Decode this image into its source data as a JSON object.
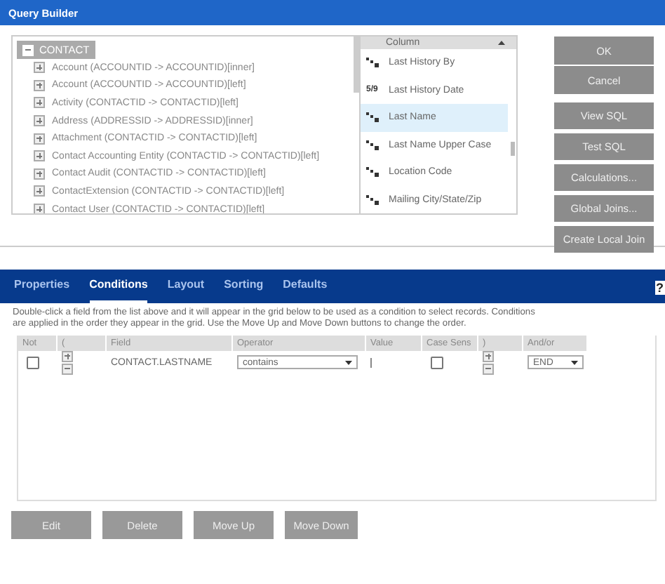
{
  "window": {
    "title": "Query Builder"
  },
  "tree": {
    "label": "CONTACT",
    "expanded": true,
    "children": [
      {
        "label": "Account (ACCOUNTID -> ACCOUNTID)[inner]",
        "expanded": false
      },
      {
        "label": "Account (ACCOUNTID -> ACCOUNTID)[left]",
        "expanded": false
      },
      {
        "label": "Activity (CONTACTID -> CONTACTID)[left]",
        "expanded": false
      },
      {
        "label": "Address (ADDRESSID -> ADDRESSID)[inner]",
        "expanded": false
      },
      {
        "label": "Attachment (CONTACTID -> CONTACTID)[left]",
        "expanded": false
      },
      {
        "label": "Contact Accounting Entity (CONTACTID -> CONTACTID)[left]",
        "expanded": false
      },
      {
        "label": "Contact Audit (CONTACTID -> CONTACTID)[left]",
        "expanded": false
      },
      {
        "label": "ContactExtension (CONTACTID -> CONTACTID)[left]",
        "expanded": false
      },
      {
        "label": "Contact User (CONTACTID -> CONTACTID)[left]",
        "expanded": false
      }
    ]
  },
  "columns": {
    "header": "Column",
    "items": [
      {
        "label": "Last History By",
        "kind": "text",
        "selected": false
      },
      {
        "label": "Last History Date",
        "kind": "date",
        "type_label": "5/9",
        "selected": false
      },
      {
        "label": "Last Name",
        "kind": "text",
        "selected": true
      },
      {
        "label": "Last Name Upper Case",
        "kind": "text",
        "selected": false
      },
      {
        "label": "Location Code",
        "kind": "text",
        "selected": false
      },
      {
        "label": "Mailing City/State/Zip",
        "kind": "text",
        "selected": false
      }
    ]
  },
  "side_buttons": [
    [
      "OK",
      "Cancel"
    ],
    [
      "View SQL",
      "Test SQL",
      "Calculations...",
      "Global Joins...",
      "Create Local Join"
    ]
  ],
  "tabs": [
    {
      "label": "Properties",
      "selected": false
    },
    {
      "label": "Conditions",
      "selected": true
    },
    {
      "label": "Layout",
      "selected": false
    },
    {
      "label": "Sorting",
      "selected": false
    },
    {
      "label": "Defaults",
      "selected": false
    }
  ],
  "help": "?",
  "description": "Double-click a field from the list above and it will appear in the grid below to be used as a condition to select records. Conditions are applied in the order they appear in the grid. Use the Move Up and Move Down buttons to change the order.",
  "grid": {
    "columns": [
      "Not",
      "(",
      "Field",
      "Operator",
      "Value",
      "Case Sens",
      ")",
      "And/or"
    ],
    "rows": [
      {
        "not": false,
        "field": "CONTACT.LASTNAME",
        "operator": "contains",
        "case_sensitive": false,
        "and_or": "END"
      }
    ]
  },
  "bottom_buttons": [
    "Edit",
    "Delete",
    "Move Up",
    "Move Down"
  ]
}
